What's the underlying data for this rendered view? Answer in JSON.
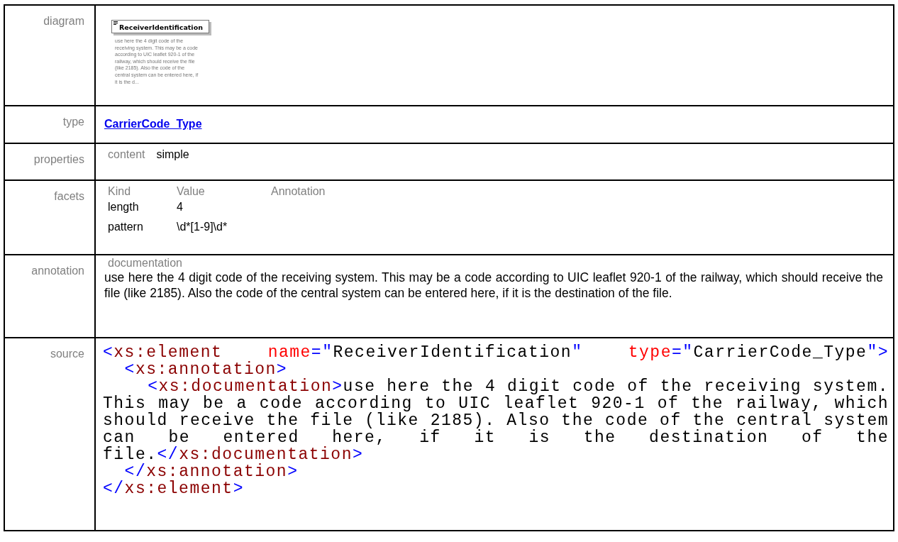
{
  "rows": [
    {
      "kind": "diagram",
      "label": "diagram",
      "element": {
        "name": "ReceiverIdentification",
        "note": "use here the 4 digit code of the receiving system. This may be a code according to UIC leaflet 920-1 of the railway, which should receive the file (like 2185). Also the code of the central system can be entered here, if it is the d..."
      }
    },
    {
      "kind": "type",
      "label": "type",
      "link": "CarrierCode_Type"
    },
    {
      "kind": "properties",
      "label": "properties",
      "items": [
        {
          "name": "content",
          "value": "simple"
        }
      ]
    },
    {
      "kind": "facets",
      "label": "facets",
      "columns": [
        "Kind",
        "Value",
        "Annotation"
      ],
      "items": [
        {
          "facet": "length",
          "value": "4"
        },
        {
          "facet": "pattern",
          "value": "\\d*[1-9]\\d*"
        }
      ]
    },
    {
      "kind": "annotation",
      "label": "annotation",
      "heading": "documentation",
      "text": "use here the 4 digit code of the receiving system. This may be a code according to UIC leaflet 920-1 of the railway, which should receive the file (like 2185). Also the code of the central system can be entered here, if it is the destination of the file."
    },
    {
      "kind": "source",
      "label": "source",
      "lines": [
        {
          "justified": true,
          "tokens": [
            {
              "kind": "punct",
              "text": "<"
            },
            {
              "kind": "tag",
              "text": "xs:element "
            },
            {
              "kind": "attr",
              "text": "name"
            },
            {
              "kind": "punct",
              "text": "=\""
            },
            {
              "kind": "val",
              "text": "ReceiverIdentification"
            },
            {
              "kind": "punct",
              "text": "\" "
            },
            {
              "kind": "attr",
              "text": "type"
            },
            {
              "kind": "punct",
              "text": "=\""
            },
            {
              "kind": "val",
              "text": "CarrierCode_Type"
            },
            {
              "kind": "punct",
              "text": "\">"
            }
          ]
        },
        {
          "justified": false,
          "tokens": [
            {
              "kind": "punct",
              "text": "  <"
            },
            {
              "kind": "tag",
              "text": "xs:annotation"
            },
            {
              "kind": "punct",
              "text": ">"
            }
          ]
        },
        {
          "justified": true,
          "tokens": [
            {
              "kind": "punct",
              "text": "    <"
            },
            {
              "kind": "tag",
              "text": "xs:documentation"
            },
            {
              "kind": "punct",
              "text": ">"
            },
            {
              "kind": "val",
              "text": "use here the 4 digit code of the receiving system."
            }
          ]
        },
        {
          "justified": true,
          "tokens": [
            {
              "kind": "val",
              "text": "This may be a code according to UIC leaflet 920-1 of the railway, which"
            }
          ]
        },
        {
          "justified": true,
          "tokens": [
            {
              "kind": "val",
              "text": "should receive the file (like 2185). Also the code of the central system"
            }
          ]
        },
        {
          "justified": true,
          "tokens": [
            {
              "kind": "val",
              "text": "can be entered here, if it is the destination of the"
            }
          ]
        },
        {
          "justified": false,
          "tokens": [
            {
              "kind": "val",
              "text": "file."
            },
            {
              "kind": "punct",
              "text": "</"
            },
            {
              "kind": "tag",
              "text": "xs:documentation"
            },
            {
              "kind": "punct",
              "text": ">"
            }
          ]
        },
        {
          "justified": false,
          "tokens": [
            {
              "kind": "punct",
              "text": "  </"
            },
            {
              "kind": "tag",
              "text": "xs:annotation"
            },
            {
              "kind": "punct",
              "text": ">"
            }
          ]
        },
        {
          "justified": false,
          "tokens": [
            {
              "kind": "punct",
              "text": "</"
            },
            {
              "kind": "tag",
              "text": "xs:element"
            },
            {
              "kind": "punct",
              "text": ">"
            }
          ]
        }
      ]
    }
  ]
}
